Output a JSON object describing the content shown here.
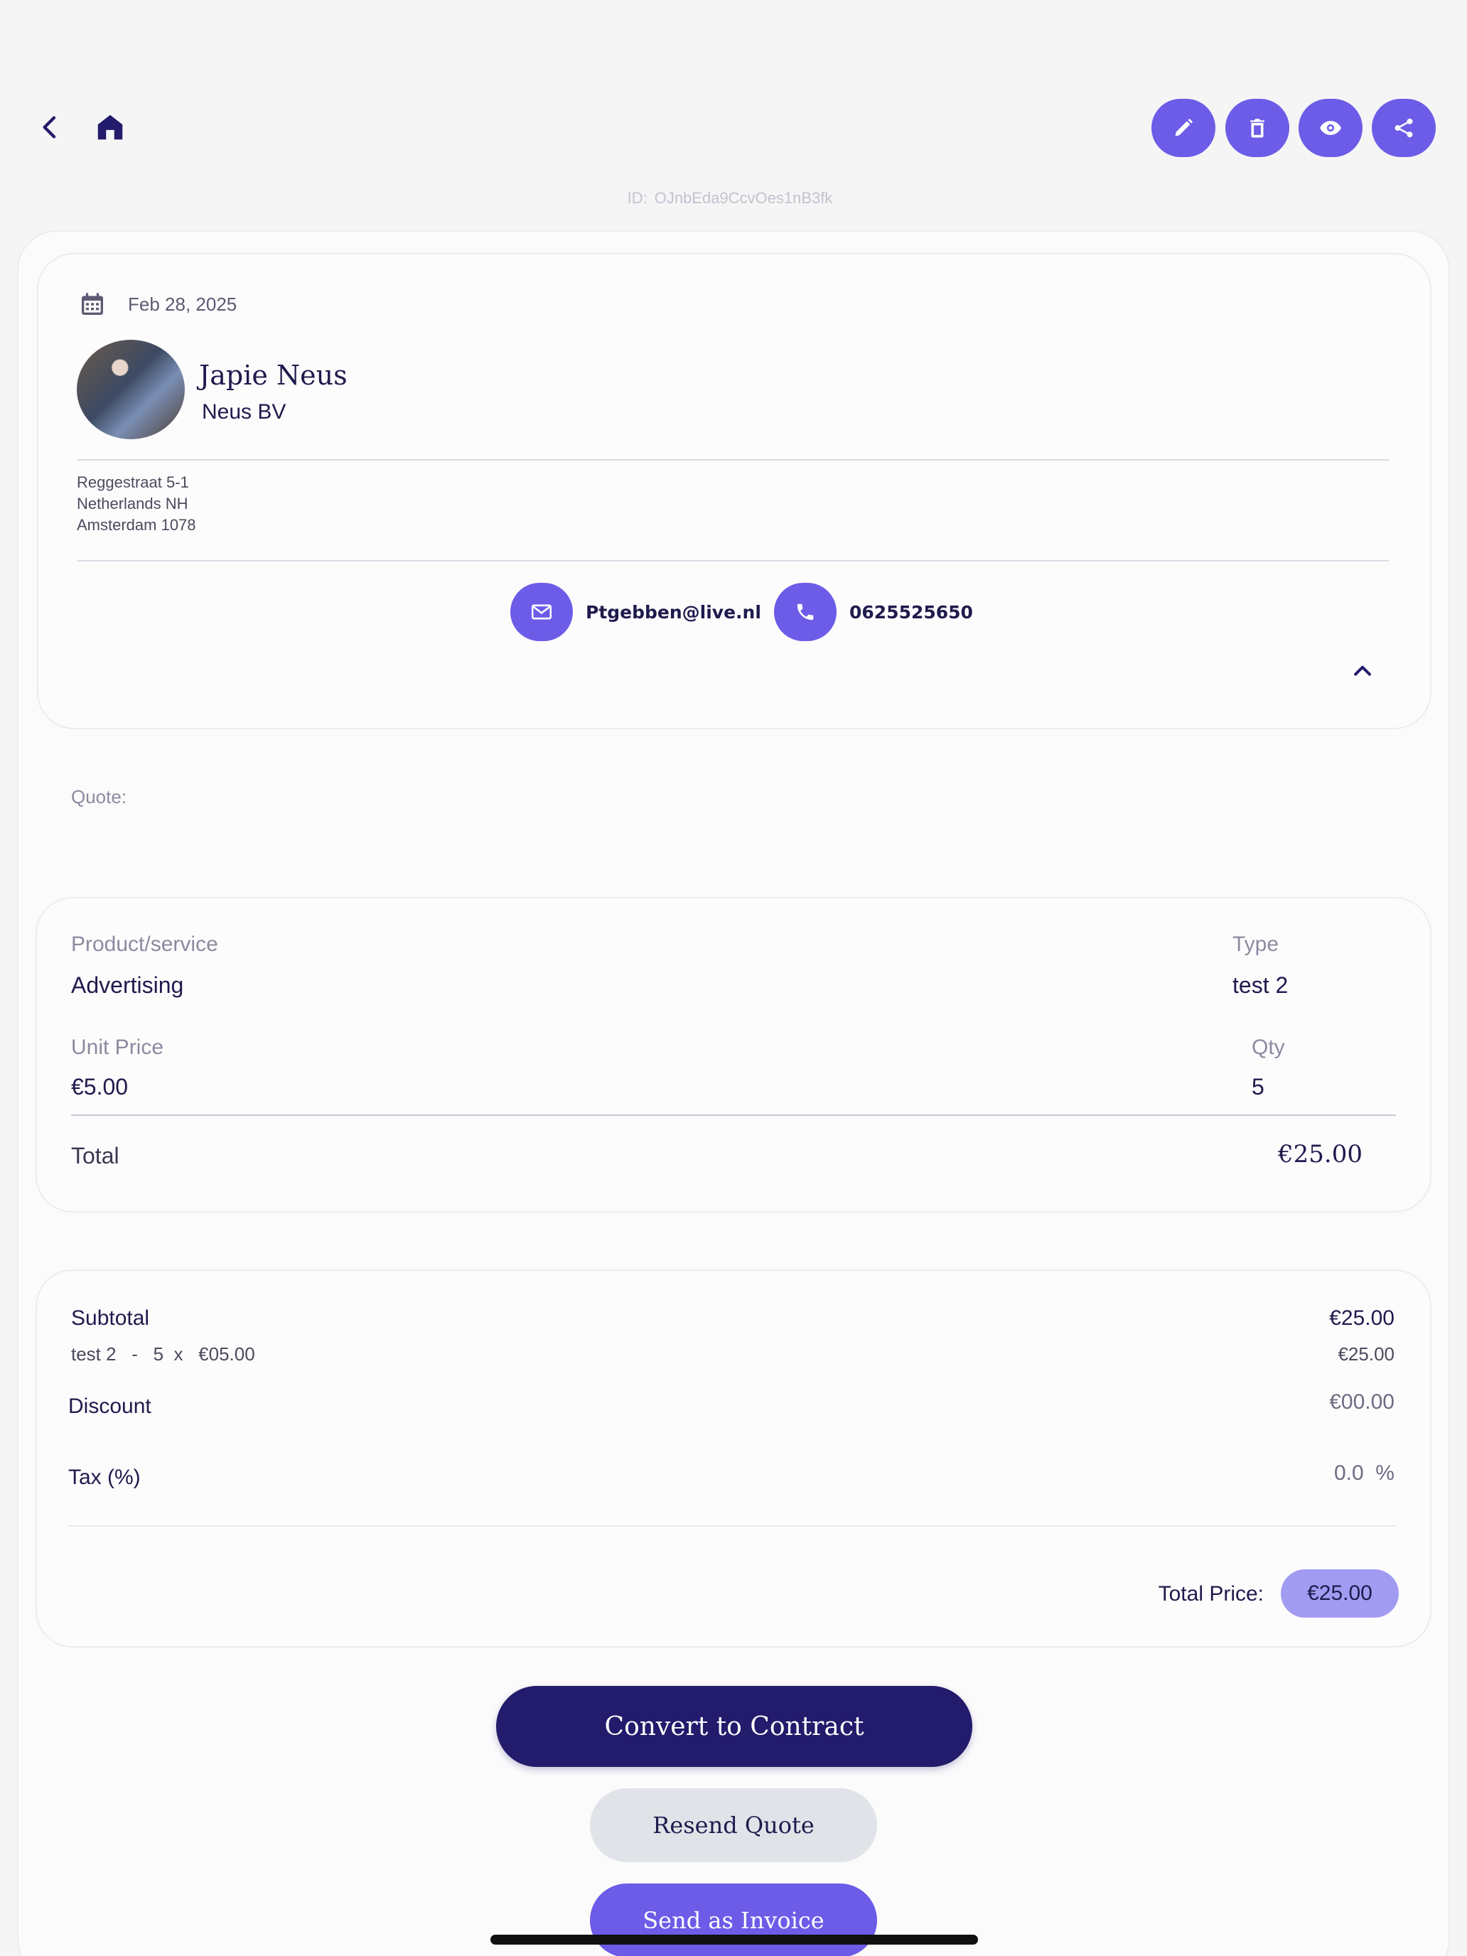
{
  "header": {
    "back_icon": "chevron-left-icon",
    "home_icon": "home-icon",
    "actions": [
      {
        "name": "edit",
        "icon": "pencil-icon"
      },
      {
        "name": "delete",
        "icon": "trash-icon"
      },
      {
        "name": "preview",
        "icon": "eye-icon"
      },
      {
        "name": "share",
        "icon": "share-icon"
      }
    ],
    "id_label": "ID:",
    "id_value": "OJnbEda9CcvOes1nB3fk"
  },
  "contact": {
    "date": "Feb 28, 2025",
    "name": "Japie Neus",
    "company": "Neus BV",
    "address": [
      "Reggestraat 5-1",
      "Netherlands  NH",
      "Amsterdam  1078"
    ],
    "email": "Ptgebben@live.nl",
    "phone": "0625525650"
  },
  "quote": {
    "label": "Quote:"
  },
  "item": {
    "product_label": "Product/service",
    "product_value": "Advertising",
    "type_label": "Type",
    "type_value": "test 2",
    "unit_price_label": "Unit Price",
    "unit_price_value": "€5.00",
    "qty_label": "Qty",
    "qty_value": "5",
    "total_label": "Total",
    "total_value": "€25.00"
  },
  "summary": {
    "subtotal_label": "Subtotal",
    "subtotal_value": "€25.00",
    "line_detail": "test 2   -   5  x   €05.00",
    "line_value": "€25.00",
    "discount_label": "Discount",
    "discount_value": "€00.00",
    "tax_label": "Tax (%)",
    "tax_value": "0.0  %",
    "total_price_label": "Total Price:",
    "total_price_value": "€25.00"
  },
  "buttons": {
    "convert": "Convert to Contract",
    "resend": "Resend Quote",
    "invoice": "Send as Invoice"
  },
  "colors": {
    "accent": "#6c5ce7",
    "navy": "#231b6b",
    "badge": "#a29bf2",
    "background": "#f5f5f6"
  }
}
